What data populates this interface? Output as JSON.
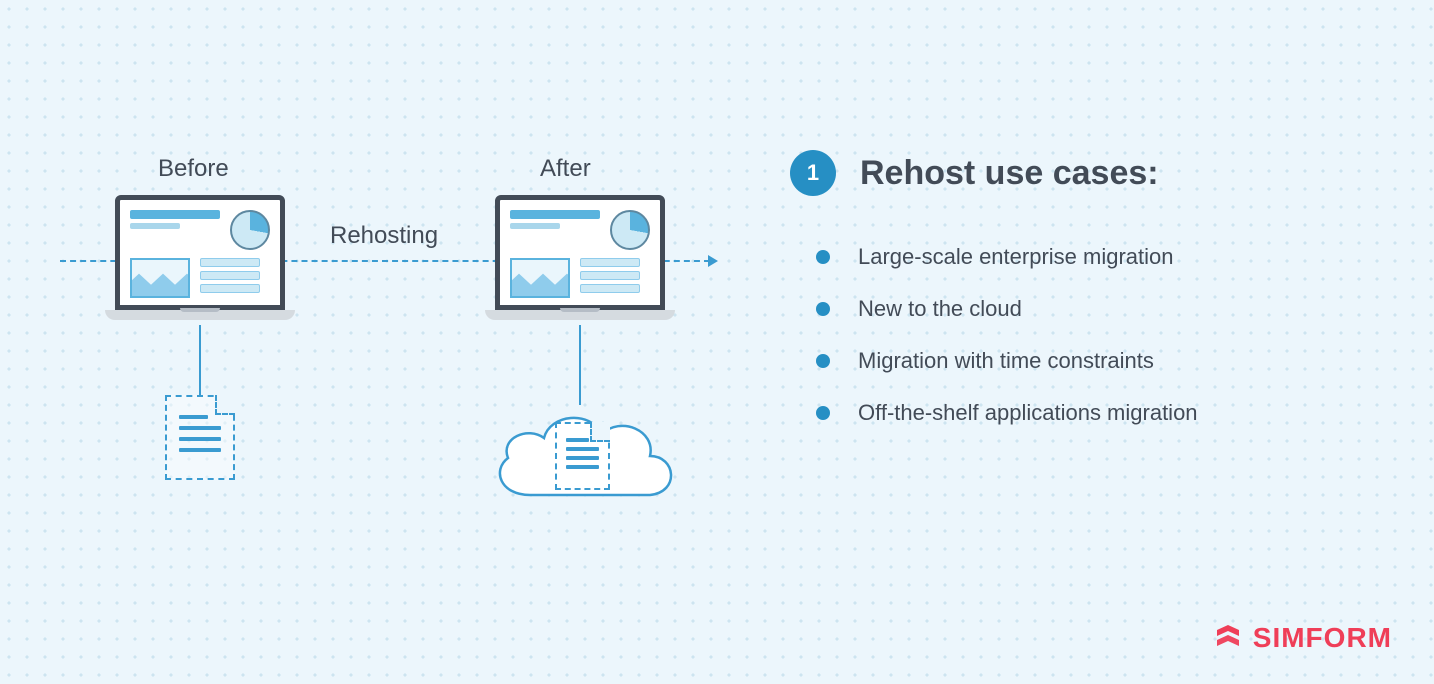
{
  "diagram": {
    "before_label": "Before",
    "after_label": "After",
    "transition_label": "Rehosting"
  },
  "panel": {
    "badge_number": "1",
    "heading": "Rehost use cases:",
    "bullets": [
      "Large-scale enterprise migration",
      "New to the cloud",
      "Migration with time constraints",
      "Off-the-shelf applications migration"
    ]
  },
  "brand": {
    "name": "SIMFORM"
  }
}
